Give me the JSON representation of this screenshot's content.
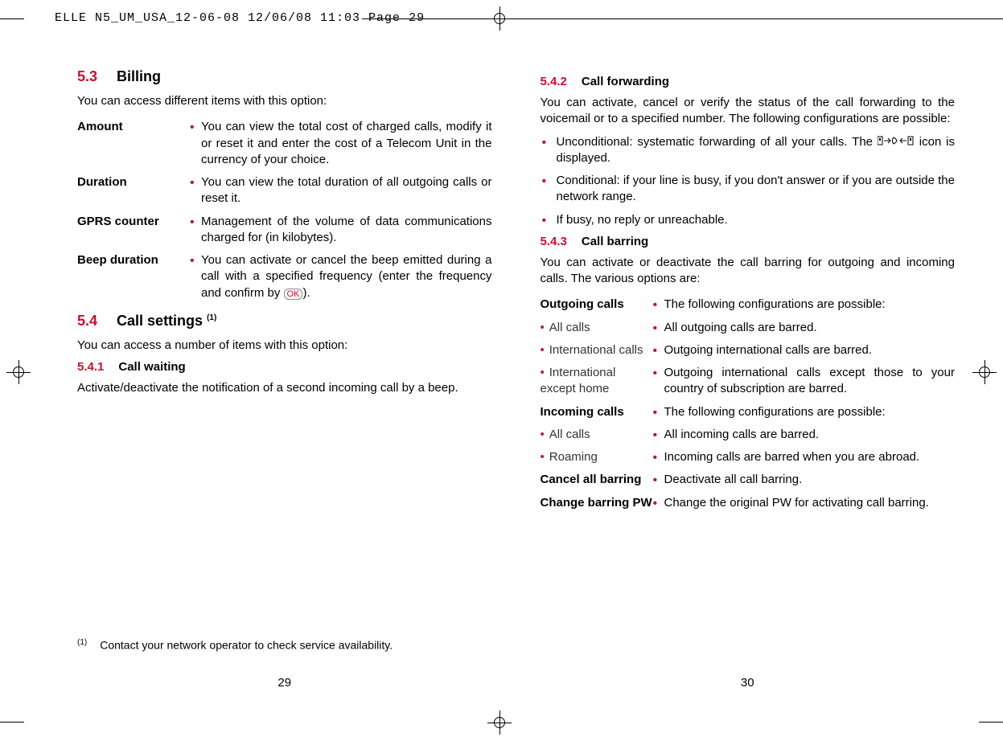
{
  "crop_header": "ELLE N5_UM_USA_12-06-08  12/06/08  11:03  Page 29",
  "left": {
    "s53_num": "5.3",
    "s53_title": "Billing",
    "s53_intro": "You can access different items with this option:",
    "billing": {
      "amount_term": "Amount",
      "amount_desc": "You can view the total cost of charged calls, modify it or reset it and enter the cost of a Telecom Unit in the currency of your choice.",
      "duration_term": "Duration",
      "duration_desc": "You can view the total duration of all outgoing calls or reset it.",
      "gprs_term": "GPRS counter",
      "gprs_desc": "Management of the volume of data communications charged for (in kilobytes).",
      "beep_term": "Beep duration",
      "beep_desc_pre": "You can activate or cancel the beep emitted during a call with a specified frequency (enter the frequency and confirm by ",
      "beep_desc_post": ")."
    },
    "ok_label": "OK",
    "s54_num": "5.4",
    "s54_title": "Call settings",
    "s54_sup": "(1)",
    "s54_intro": "You can access a number of items with this option:",
    "s541_num": "5.4.1",
    "s541_title": "Call waiting",
    "s541_text": "Activate/deactivate the notification of a second incoming call by a beep.",
    "footnote_sup": "(1)",
    "footnote_text": "Contact your network operator to check service availability.",
    "page_num": "29"
  },
  "right": {
    "s542_num": "5.4.2",
    "s542_title": "Call forwarding",
    "s542_text": "You can activate, cancel or verify the status of the call forwarding to the voicemail or to a specified number. The following configurations are possible:",
    "fwd": {
      "uncond_pre": "Unconditional: systematic forwarding of all your calls. The ",
      "uncond_post": " icon is displayed.",
      "cond": "Conditional: if your line is busy, if you don't answer or if you are outside the network range.",
      "ifbusy": "If busy, no reply or unreachable."
    },
    "s543_num": "5.4.3",
    "s543_title": "Call barring",
    "s543_text": "You can activate or deactivate the call barring for outgoing and incoming calls. The various options are:",
    "barring": {
      "out_term": "Outgoing calls",
      "out_desc": "The following configurations are possible:",
      "all_out_term": "All calls",
      "all_out_desc": "All outgoing calls are barred.",
      "intl_term": "International calls",
      "intl_desc": "Outgoing international calls are barred.",
      "intl_ex_term": "International except home",
      "intl_ex_desc": "Outgoing international calls except those to your country of subscription are barred.",
      "in_term": "Incoming calls",
      "in_desc": "The following configurations are possible:",
      "all_in_term": "All calls",
      "all_in_desc": "All incoming calls are barred.",
      "roam_term": "Roaming",
      "roam_desc": "Incoming calls are barred when you are abroad.",
      "cancel_term": "Cancel all barring",
      "cancel_desc": "Deactivate all call barring.",
      "pw_term": "Change barring PW",
      "pw_desc": "Change the original PW for activating call barring."
    },
    "page_num": "30"
  }
}
